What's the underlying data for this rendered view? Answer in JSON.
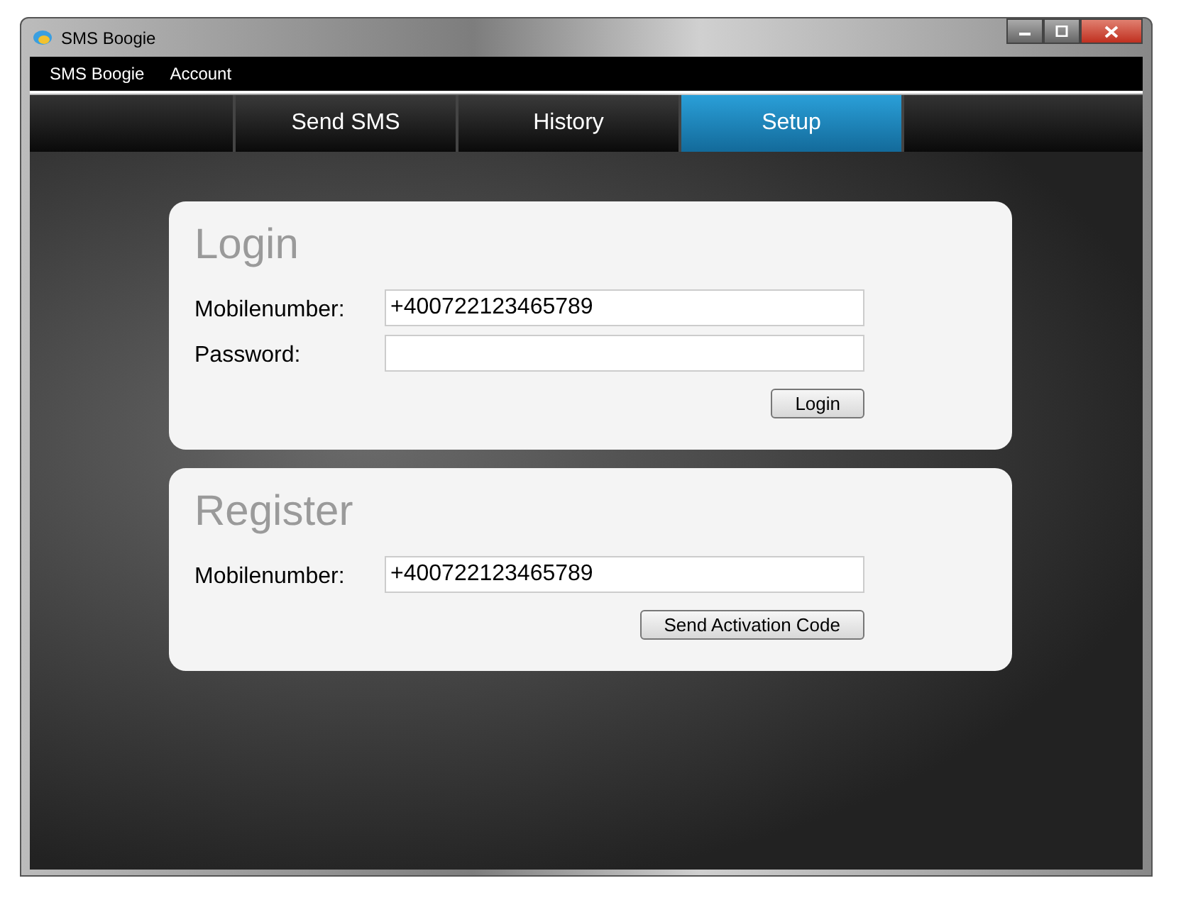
{
  "window": {
    "title": "SMS Boogie"
  },
  "menu": [
    "SMS Boogie",
    "Account"
  ],
  "tabs": [
    {
      "label": "Send SMS",
      "selected": false
    },
    {
      "label": "History",
      "selected": false
    },
    {
      "label": "Setup",
      "selected": true
    }
  ],
  "sections": [
    {
      "title": "Login",
      "fields": [
        {
          "label": "Mobilenumber:",
          "value": "+400722123465789"
        },
        {
          "label": "Password:"
        }
      ],
      "button": "Login"
    },
    {
      "title": "Register",
      "fields": [
        {
          "label": "Mobilenumber:",
          "value": "+400722123465789"
        }
      ],
      "button": "Send Activation Code"
    }
  ]
}
